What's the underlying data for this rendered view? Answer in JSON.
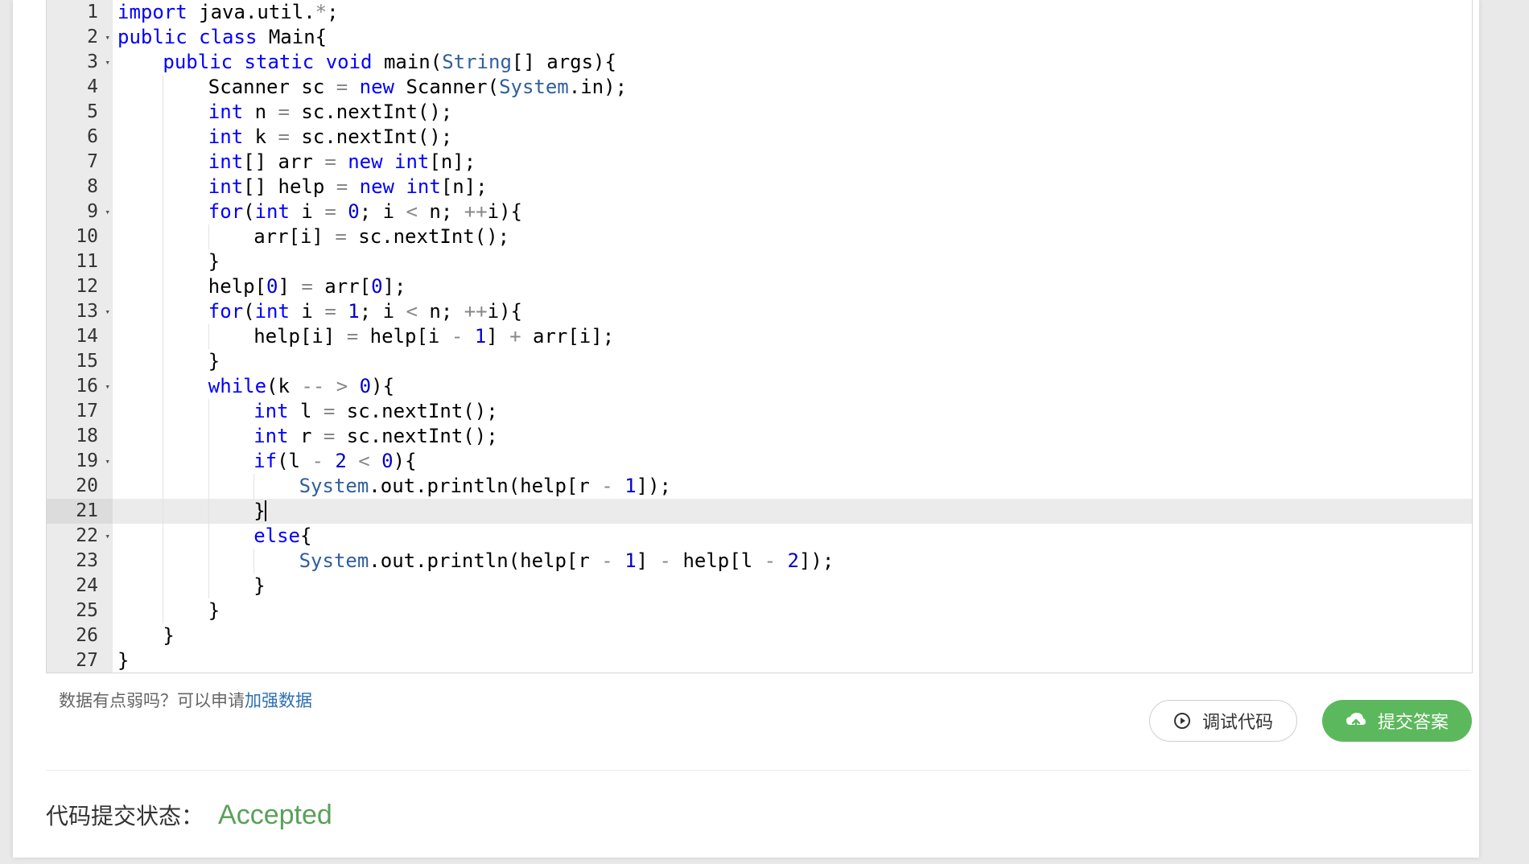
{
  "editor": {
    "active_line": 21,
    "lines": [
      {
        "n": "1",
        "fold": false,
        "indent": 0,
        "tokens": [
          [
            "kw",
            "import"
          ],
          [
            "t",
            " java.util."
          ],
          [
            "op",
            "*"
          ],
          [
            "t",
            ";"
          ]
        ]
      },
      {
        "n": "2",
        "fold": true,
        "indent": 0,
        "tokens": [
          [
            "kw",
            "public"
          ],
          [
            "t",
            " "
          ],
          [
            "kw",
            "class"
          ],
          [
            "t",
            " Main{"
          ]
        ]
      },
      {
        "n": "3",
        "fold": true,
        "indent": 1,
        "tokens": [
          [
            "kw",
            "public"
          ],
          [
            "t",
            " "
          ],
          [
            "kw",
            "static"
          ],
          [
            "t",
            " "
          ],
          [
            "kw",
            "void"
          ],
          [
            "t",
            " main("
          ],
          [
            "sys",
            "String"
          ],
          [
            "t",
            "[] args){"
          ]
        ]
      },
      {
        "n": "4",
        "fold": false,
        "indent": 2,
        "tokens": [
          [
            "t",
            "Scanner sc "
          ],
          [
            "op",
            "="
          ],
          [
            "t",
            " "
          ],
          [
            "kw",
            "new"
          ],
          [
            "t",
            " Scanner("
          ],
          [
            "sys",
            "System"
          ],
          [
            "t",
            ".in);"
          ]
        ]
      },
      {
        "n": "5",
        "fold": false,
        "indent": 2,
        "tokens": [
          [
            "ty",
            "int"
          ],
          [
            "t",
            " n "
          ],
          [
            "op",
            "="
          ],
          [
            "t",
            " sc.nextInt();"
          ]
        ]
      },
      {
        "n": "6",
        "fold": false,
        "indent": 2,
        "tokens": [
          [
            "ty",
            "int"
          ],
          [
            "t",
            " k "
          ],
          [
            "op",
            "="
          ],
          [
            "t",
            " sc.nextInt();"
          ]
        ]
      },
      {
        "n": "7",
        "fold": false,
        "indent": 2,
        "tokens": [
          [
            "ty",
            "int"
          ],
          [
            "t",
            "[] arr "
          ],
          [
            "op",
            "="
          ],
          [
            "t",
            " "
          ],
          [
            "kw",
            "new"
          ],
          [
            "t",
            " "
          ],
          [
            "ty",
            "int"
          ],
          [
            "t",
            "[n];"
          ]
        ]
      },
      {
        "n": "8",
        "fold": false,
        "indent": 2,
        "tokens": [
          [
            "ty",
            "int"
          ],
          [
            "t",
            "[] help "
          ],
          [
            "op",
            "="
          ],
          [
            "t",
            " "
          ],
          [
            "kw",
            "new"
          ],
          [
            "t",
            " "
          ],
          [
            "ty",
            "int"
          ],
          [
            "t",
            "[n];"
          ]
        ]
      },
      {
        "n": "9",
        "fold": true,
        "indent": 2,
        "tokens": [
          [
            "kw",
            "for"
          ],
          [
            "t",
            "("
          ],
          [
            "ty",
            "int"
          ],
          [
            "t",
            " i "
          ],
          [
            "op",
            "="
          ],
          [
            "t",
            " "
          ],
          [
            "nm",
            "0"
          ],
          [
            "t",
            "; i "
          ],
          [
            "op",
            "<"
          ],
          [
            "t",
            " n; "
          ],
          [
            "op",
            "++"
          ],
          [
            "t",
            "i){"
          ]
        ]
      },
      {
        "n": "10",
        "fold": false,
        "indent": 3,
        "tokens": [
          [
            "t",
            "arr[i] "
          ],
          [
            "op",
            "="
          ],
          [
            "t",
            " sc.nextInt();"
          ]
        ]
      },
      {
        "n": "11",
        "fold": false,
        "indent": 2,
        "tokens": [
          [
            "t",
            "}"
          ]
        ]
      },
      {
        "n": "12",
        "fold": false,
        "indent": 2,
        "tokens": [
          [
            "t",
            "help["
          ],
          [
            "nm",
            "0"
          ],
          [
            "t",
            "] "
          ],
          [
            "op",
            "="
          ],
          [
            "t",
            " arr["
          ],
          [
            "nm",
            "0"
          ],
          [
            "t",
            "];"
          ]
        ]
      },
      {
        "n": "13",
        "fold": true,
        "indent": 2,
        "tokens": [
          [
            "kw",
            "for"
          ],
          [
            "t",
            "("
          ],
          [
            "ty",
            "int"
          ],
          [
            "t",
            " i "
          ],
          [
            "op",
            "="
          ],
          [
            "t",
            " "
          ],
          [
            "nm",
            "1"
          ],
          [
            "t",
            "; i "
          ],
          [
            "op",
            "<"
          ],
          [
            "t",
            " n; "
          ],
          [
            "op",
            "++"
          ],
          [
            "t",
            "i){"
          ]
        ]
      },
      {
        "n": "14",
        "fold": false,
        "indent": 3,
        "tokens": [
          [
            "t",
            "help[i] "
          ],
          [
            "op",
            "="
          ],
          [
            "t",
            " help[i "
          ],
          [
            "op",
            "-"
          ],
          [
            "t",
            " "
          ],
          [
            "nm",
            "1"
          ],
          [
            "t",
            "] "
          ],
          [
            "op",
            "+"
          ],
          [
            "t",
            " arr[i];"
          ]
        ]
      },
      {
        "n": "15",
        "fold": false,
        "indent": 2,
        "tokens": [
          [
            "t",
            "}"
          ]
        ]
      },
      {
        "n": "16",
        "fold": true,
        "indent": 2,
        "tokens": [
          [
            "kw",
            "while"
          ],
          [
            "t",
            "(k "
          ],
          [
            "op",
            "--"
          ],
          [
            "t",
            " "
          ],
          [
            "op",
            ">"
          ],
          [
            "t",
            " "
          ],
          [
            "nm",
            "0"
          ],
          [
            "t",
            "){"
          ]
        ]
      },
      {
        "n": "17",
        "fold": false,
        "indent": 3,
        "tokens": [
          [
            "ty",
            "int"
          ],
          [
            "t",
            " l "
          ],
          [
            "op",
            "="
          ],
          [
            "t",
            " sc.nextInt();"
          ]
        ]
      },
      {
        "n": "18",
        "fold": false,
        "indent": 3,
        "tokens": [
          [
            "ty",
            "int"
          ],
          [
            "t",
            " r "
          ],
          [
            "op",
            "="
          ],
          [
            "t",
            " sc.nextInt();"
          ]
        ]
      },
      {
        "n": "19",
        "fold": true,
        "indent": 3,
        "tokens": [
          [
            "kw",
            "if"
          ],
          [
            "t",
            "(l "
          ],
          [
            "op",
            "-"
          ],
          [
            "t",
            " "
          ],
          [
            "nm",
            "2"
          ],
          [
            "t",
            " "
          ],
          [
            "op",
            "<"
          ],
          [
            "t",
            " "
          ],
          [
            "nm",
            "0"
          ],
          [
            "t",
            "){"
          ]
        ]
      },
      {
        "n": "20",
        "fold": false,
        "indent": 4,
        "tokens": [
          [
            "sys",
            "System"
          ],
          [
            "t",
            ".out.println(help[r "
          ],
          [
            "op",
            "-"
          ],
          [
            "t",
            " "
          ],
          [
            "nm",
            "1"
          ],
          [
            "t",
            "]);"
          ]
        ]
      },
      {
        "n": "21",
        "fold": false,
        "indent": 3,
        "tokens": [
          [
            "t",
            "}"
          ]
        ]
      },
      {
        "n": "22",
        "fold": true,
        "indent": 3,
        "tokens": [
          [
            "kw",
            "else"
          ],
          [
            "t",
            "{"
          ]
        ]
      },
      {
        "n": "23",
        "fold": false,
        "indent": 4,
        "tokens": [
          [
            "sys",
            "System"
          ],
          [
            "t",
            ".out.println(help[r "
          ],
          [
            "op",
            "-"
          ],
          [
            "t",
            " "
          ],
          [
            "nm",
            "1"
          ],
          [
            "t",
            "] "
          ],
          [
            "op",
            "-"
          ],
          [
            "t",
            " help[l "
          ],
          [
            "op",
            "-"
          ],
          [
            "t",
            " "
          ],
          [
            "nm",
            "2"
          ],
          [
            "t",
            "]);"
          ]
        ]
      },
      {
        "n": "24",
        "fold": false,
        "indent": 3,
        "tokens": [
          [
            "t",
            "}"
          ]
        ]
      },
      {
        "n": "25",
        "fold": false,
        "indent": 2,
        "tokens": [
          [
            "t",
            "}"
          ]
        ]
      },
      {
        "n": "26",
        "fold": false,
        "indent": 1,
        "tokens": [
          [
            "t",
            "}"
          ]
        ]
      },
      {
        "n": "27",
        "fold": false,
        "indent": 0,
        "tokens": [
          [
            "t",
            "}"
          ]
        ]
      }
    ]
  },
  "hint": {
    "text": "数据有点弱吗？可以申请",
    "link": "加强数据"
  },
  "buttons": {
    "debug_label": "调试代码",
    "submit_label": "提交答案",
    "debug_icon": "play-circle-icon",
    "submit_icon": "cloud-upload-icon"
  },
  "status": {
    "label": "代码提交状态：",
    "value": "Accepted",
    "value_color": "#5aa05a"
  },
  "colors": {
    "accent_green": "#5cb85c",
    "keyword": "#0000ff",
    "number": "#0000cd",
    "builtin": "#2f5f9e",
    "link": "#2d6fb4"
  }
}
